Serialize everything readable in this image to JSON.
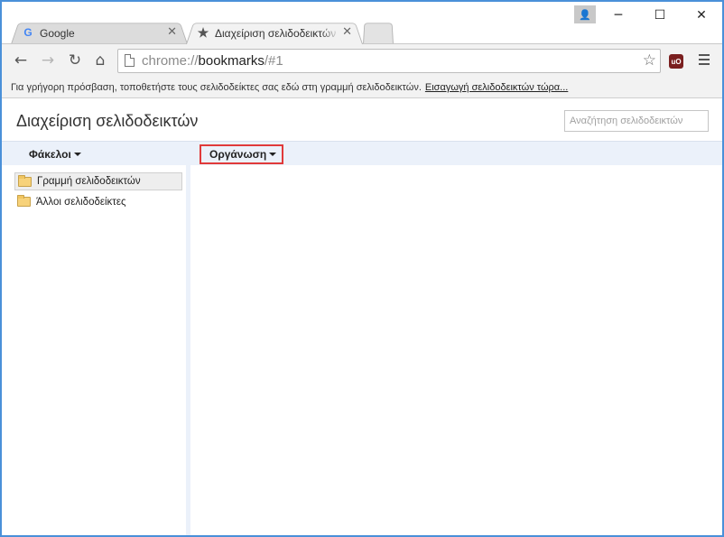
{
  "browser": {
    "tabs": [
      {
        "title": "Google",
        "icon": "google-g-icon",
        "active": false
      },
      {
        "title": "Διαχείριση σελιδοδεικτών",
        "icon": "star-icon",
        "active": true
      }
    ],
    "omnibox": {
      "url_scheme": "chrome://",
      "url_host": "bookmarks",
      "url_path": "/#1"
    },
    "window_controls": {
      "minimize": "─",
      "maximize": "☐",
      "close": "✕"
    }
  },
  "bookmark_bar": {
    "hint": "Για γρήγορη πρόσβαση, τοποθετήστε τους σελιδοδείκτες σας εδώ στη γραμμή σελιδοδεικτών.",
    "import_link": "Εισαγωγή σελιδοδεικτών τώρα..."
  },
  "page": {
    "title": "Διαχείριση σελιδοδεικτών",
    "search_placeholder": "Αναζήτηση σελιδοδεικτών"
  },
  "header": {
    "folders_label": "Φάκελοι",
    "organize_label": "Οργάνωση"
  },
  "folders": [
    {
      "label": "Γραμμή σελιδοδεικτών",
      "selected": true
    },
    {
      "label": "Άλλοι σελιδοδείκτες",
      "selected": false
    }
  ],
  "colors": {
    "window_border": "#4a90d9",
    "header_bg": "#ebf1fa",
    "highlight": "#e03a3a",
    "folder": "#f7d27a"
  }
}
